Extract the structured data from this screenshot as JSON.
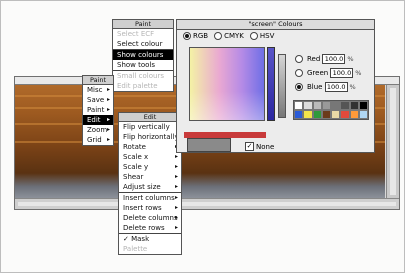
{
  "paint_menu": {
    "title": "Paint",
    "items": [
      {
        "label": "Select ECF",
        "state": "dim"
      },
      {
        "label": "Select colour",
        "state": ""
      },
      {
        "label": "Show colours",
        "state": "sel"
      },
      {
        "label": "Show tools",
        "state": ""
      },
      {
        "label": "Small colours",
        "state": "dim"
      },
      {
        "label": "Edit palette",
        "state": "dim"
      }
    ]
  },
  "main_menu": {
    "title": "Paint",
    "items": [
      {
        "label": "Misc"
      },
      {
        "label": "Save"
      },
      {
        "label": "Paint"
      },
      {
        "label": "Edit"
      },
      {
        "label": "Zoom"
      },
      {
        "label": "Grid"
      }
    ],
    "selected": "Edit"
  },
  "edit_menu": {
    "title": "Edit",
    "group1": [
      "Flip vertically",
      "Flip horizontally",
      "Rotate",
      "Scale x",
      "Scale y",
      "Shear",
      "Adjust size"
    ],
    "group2": [
      "Insert columns",
      "Insert rows",
      "Delete columns",
      "Delete rows"
    ],
    "group3": [
      {
        "label": "✓ Mask",
        "state": ""
      },
      {
        "label": "Palette",
        "state": "dim"
      }
    ]
  },
  "colours": {
    "title": "\"screen\" Colours",
    "models": [
      "RGB",
      "CMYK",
      "HSV"
    ],
    "selected_model": "RGB",
    "fields": [
      {
        "label": "Red",
        "value": "100.0",
        "unit": "%"
      },
      {
        "label": "Green",
        "value": "100.0",
        "unit": "%"
      },
      {
        "label": "Blue",
        "value": "100.0",
        "unit": "%"
      }
    ],
    "selected_field": "Blue",
    "none_label": "None",
    "none_checked": true,
    "palette_colors": [
      "#ffffff",
      "#dddddd",
      "#bbbbbb",
      "#999999",
      "#777777",
      "#555555",
      "#333333",
      "#000000",
      "#2a5bd7",
      "#f2e34b",
      "#2f9a3a",
      "#6b3a1a",
      "#e9d9a6",
      "#e24a3b",
      "#ff9a3a",
      "#b0d7f4"
    ]
  },
  "paint_window": {
    "background": "#d8d8d8"
  }
}
